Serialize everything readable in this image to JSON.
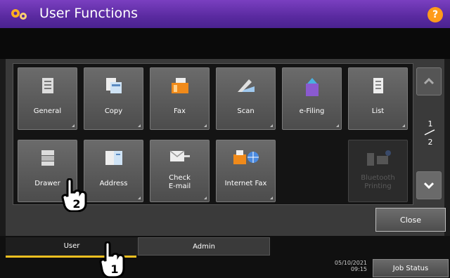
{
  "window": {
    "title": "User Functions",
    "help_label": "?"
  },
  "tiles": [
    {
      "label": "General",
      "icon": "general-icon"
    },
    {
      "label": "Copy",
      "icon": "copy-icon"
    },
    {
      "label": "Fax",
      "icon": "fax-icon"
    },
    {
      "label": "Scan",
      "icon": "scan-icon"
    },
    {
      "label": "e-Filing",
      "icon": "e-filing-icon"
    },
    {
      "label": "List",
      "icon": "list-icon"
    },
    {
      "label": "Drawer",
      "icon": "drawer-icon"
    },
    {
      "label": "Address",
      "icon": "address-book-icon"
    },
    {
      "label": "Check\nE-mail",
      "icon": "check-email-icon"
    },
    {
      "label": "Internet Fax",
      "icon": "internet-fax-icon"
    },
    {
      "label": "Bluetooth\nPrinting",
      "icon": "bluetooth-printing-icon",
      "disabled": true
    }
  ],
  "pager": {
    "current": "1",
    "total": "2"
  },
  "close_label": "Close",
  "tabs": {
    "user": "User",
    "admin": "Admin"
  },
  "status": {
    "date": "05/10/2021",
    "time": "09:15",
    "job_status_label": "Job Status"
  },
  "annotations": {
    "step1": "1",
    "step2": "2"
  },
  "colors": {
    "title_bar": "#5a2aa0",
    "help": "#ff9b1a",
    "active_tab_underline": "#f0c020"
  }
}
